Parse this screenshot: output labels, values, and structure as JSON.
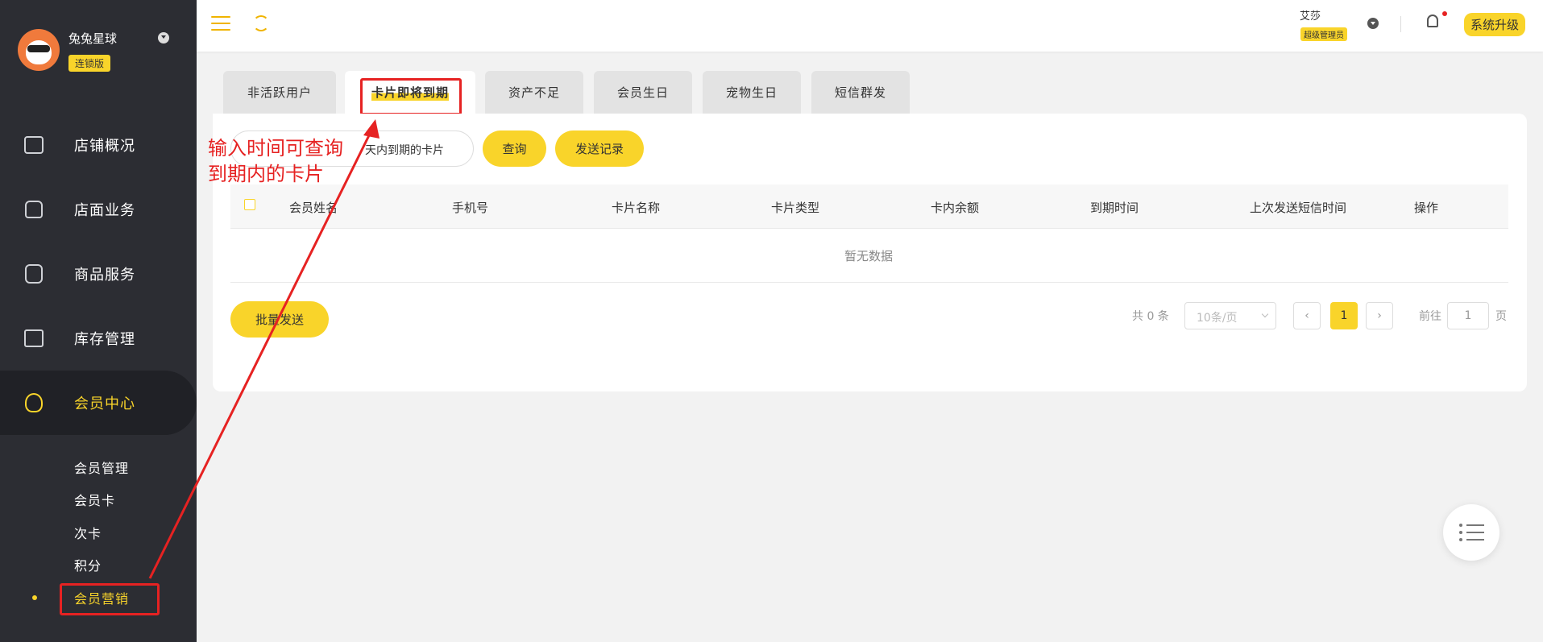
{
  "sidebar": {
    "store_name": "兔兔星球",
    "store_badge": "连锁版",
    "nav": [
      {
        "label": "店铺概况"
      },
      {
        "label": "店面业务"
      },
      {
        "label": "商品服务"
      },
      {
        "label": "库存管理"
      },
      {
        "label": "会员中心"
      }
    ],
    "sub_items": [
      {
        "label": "会员管理"
      },
      {
        "label": "会员卡"
      },
      {
        "label": "次卡"
      },
      {
        "label": "积分"
      },
      {
        "label": "会员营销"
      }
    ]
  },
  "header": {
    "user_name": "艾莎",
    "user_role": "超级管理员",
    "upgrade_label": "系统升级"
  },
  "tabs": [
    {
      "label": "非活跃用户"
    },
    {
      "label": "卡片即将到期"
    },
    {
      "label": "资产不足"
    },
    {
      "label": "会员生日"
    },
    {
      "label": "宠物生日"
    },
    {
      "label": "短信群发"
    }
  ],
  "filter": {
    "days_suffix": "天内到期的卡片",
    "query_label": "查询",
    "send_record_label": "发送记录"
  },
  "table": {
    "columns": [
      "会员姓名",
      "手机号",
      "卡片名称",
      "卡片类型",
      "卡内余额",
      "到期时间",
      "上次发送短信时间",
      "操作"
    ],
    "empty_text": "暂无数据"
  },
  "actions": {
    "batch_send_label": "批量发送"
  },
  "pagination": {
    "total_text": "共 0 条",
    "page_size": "10条/页",
    "current_page": "1",
    "goto_label": "前往",
    "goto_value": "1",
    "page_suffix": "页"
  },
  "annotation": {
    "line1": "输入时间可查询",
    "line2": "到期内的卡片"
  },
  "colors": {
    "accent": "#f9d42a",
    "sidebar_bg": "#2c2d33",
    "annotation_red": "#e62222"
  }
}
